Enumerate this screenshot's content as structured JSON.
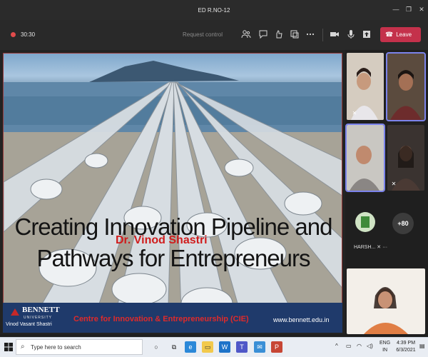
{
  "window": {
    "title": "ED R.NO-12",
    "controls": {
      "minimize": "—",
      "restore": "❐",
      "close": "✕"
    }
  },
  "toolbar": {
    "timer": "30:30",
    "request_control": "Request control",
    "leave_label": "Leave",
    "leave_color": "#c4314b"
  },
  "slide": {
    "title_line1": "Creating Innovation Pipeline and",
    "title_line2": "Pathways for Entrepreneurs",
    "author": "Dr. Vinod Shastri",
    "logo_name": "BENNETT",
    "logo_sub": "UNIVERSITY",
    "presenter_name": "Vinod Vasant Shastri",
    "cie": "Centre for Innovation & Entrepreneurship (CIE)",
    "website": "www.bennett.edu.in"
  },
  "participants": {
    "overflow_count": "+80",
    "harsh_label": "HARSH...",
    "accent": "#7b83eb"
  },
  "taskbar": {
    "search_placeholder": "Type here to search",
    "lang_top": "ENG",
    "lang_bottom": "IN",
    "time": "4:39 PM",
    "date": "6/3/2021"
  }
}
